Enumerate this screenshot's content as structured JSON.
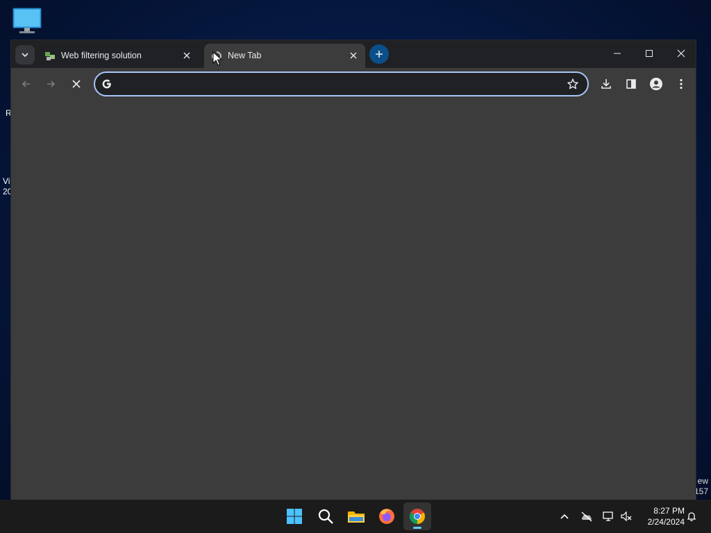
{
  "desktop": {
    "icons": [
      {
        "name": "this-pc-icon"
      }
    ],
    "left_fragments": [
      "R",
      "Vi",
      "20"
    ],
    "right_fragments": [
      "ew",
      "157"
    ]
  },
  "browser": {
    "tabs": [
      {
        "title": "Web filtering solution",
        "icon": "globe-icon",
        "active": false
      },
      {
        "title": "New Tab",
        "icon": "loading-icon",
        "active": true
      }
    ],
    "omnibox": {
      "value": "",
      "placeholder": ""
    },
    "colors": {
      "omnibox_border": "#a8c7fa",
      "tab_strip": "#202124",
      "content": "#3c3c3c",
      "new_tab_button": "#0b4f8a"
    }
  },
  "taskbar": {
    "apps": [
      {
        "name": "start-icon"
      },
      {
        "name": "search-icon"
      },
      {
        "name": "file-explorer-icon"
      },
      {
        "name": "firefox-icon"
      },
      {
        "name": "chrome-icon",
        "active": true
      }
    ],
    "clock": {
      "time": "8:27 PM",
      "date": "2/24/2024"
    }
  }
}
